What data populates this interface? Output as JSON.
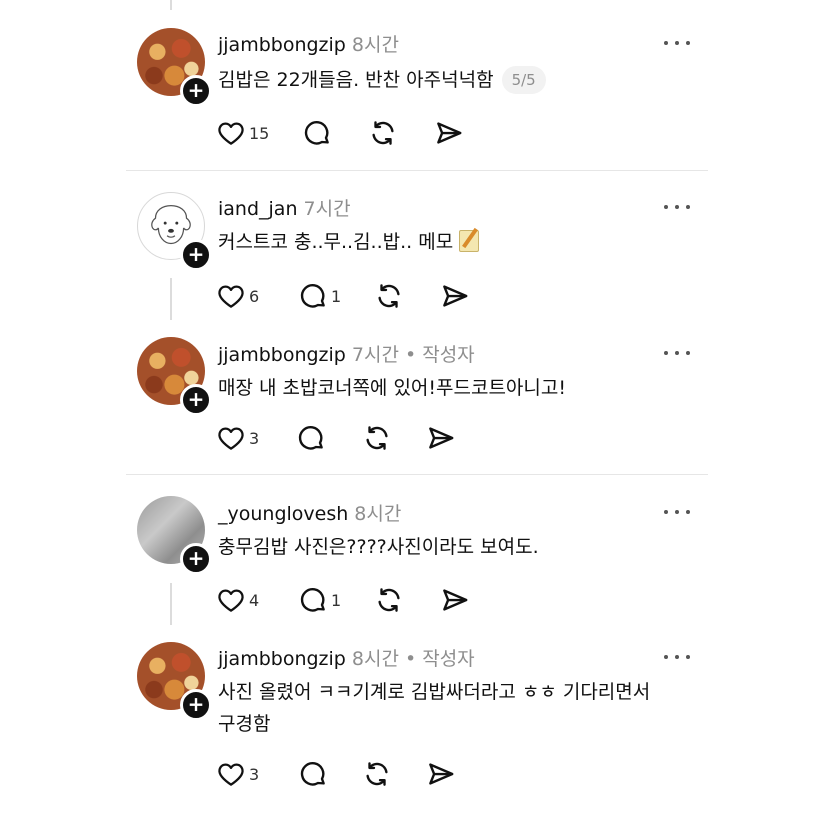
{
  "posts": [
    {
      "username": "jjambbongzip",
      "time": "8시간",
      "author_tag": "",
      "text": "김밥은 22개들음. 반찬 아주넉넉함",
      "page_badge": "5/5",
      "likes": "15",
      "replies": "",
      "avatar": "food-avatar"
    },
    {
      "username": "iand_jan",
      "time": "7시간",
      "author_tag": "",
      "text": "커스트코 충..무..김..밥.. 메모",
      "likes": "6",
      "replies": "1",
      "avatar": "dog-sketch-avatar"
    },
    {
      "username": "jjambbongzip",
      "time": "7시간",
      "author_tag": " • 작성자",
      "text": "매장 내 초밥코너쪽에 있어!푸드코트아니고!",
      "likes": "3",
      "replies": "",
      "avatar": "food-avatar"
    },
    {
      "username": "_younglovesh",
      "time": "8시간",
      "author_tag": "",
      "text": "충무김밥 사진은????사진이라도 보여도.",
      "likes": "4",
      "replies": "1",
      "avatar": "gray-photo-avatar"
    },
    {
      "username": "jjambbongzip",
      "time": "8시간",
      "author_tag": " • 작성자",
      "text_line1": "사진 올렸어 ㅋㅋ기계로 김밥싸더라고 ㅎㅎ 기다리면서",
      "text_line2": "구경함",
      "likes": "3",
      "replies": "",
      "avatar": "food-avatar"
    }
  ],
  "icons": {
    "like": "heart-icon",
    "reply": "comment-icon",
    "repost": "repost-icon",
    "share": "send-icon",
    "more": "more-icon",
    "follow": "plus-icon"
  },
  "colors": {
    "text": "#111111",
    "meta": "#8e8e8e",
    "divider": "#e6e6e6"
  }
}
